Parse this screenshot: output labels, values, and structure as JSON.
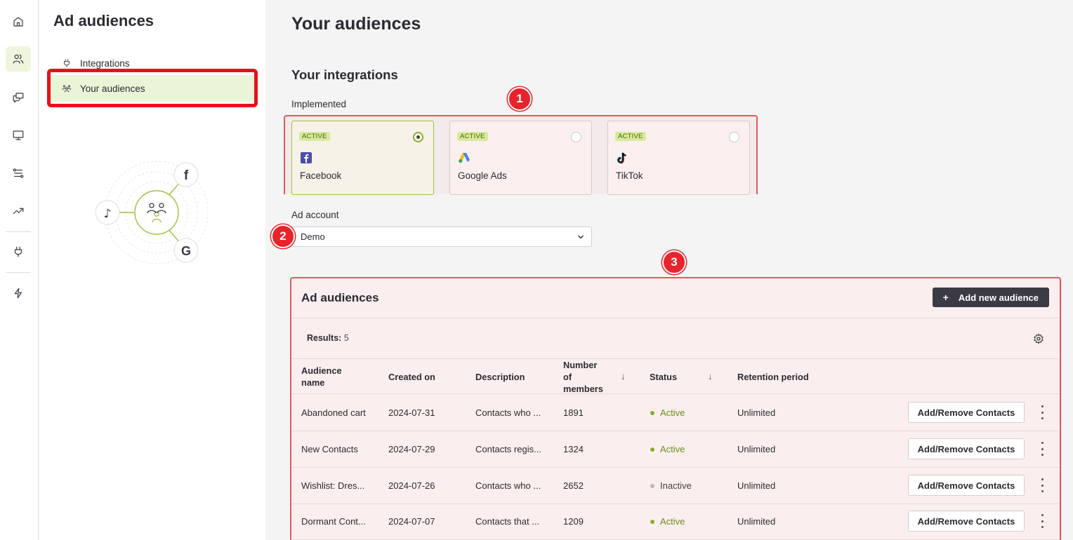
{
  "rail": {
    "icons": [
      "home-icon",
      "users-icon",
      "chat-icon",
      "monitor-icon",
      "automation-icon",
      "trend-icon",
      "plug-icon",
      "bolt-icon"
    ],
    "active": "users-icon"
  },
  "subnav": {
    "title": "Ad audiences",
    "items": [
      {
        "label": "Integrations",
        "icon": "plug-icon"
      },
      {
        "label": "Your audiences",
        "icon": "audience-icon",
        "active": true
      }
    ]
  },
  "main": {
    "title": "Your audiences",
    "integrations_title": "Your integrations",
    "implemented_label": "Implemented",
    "integrations": [
      {
        "badge": "ACTIVE",
        "name": "Facebook",
        "icon": "facebook-icon",
        "selected": true
      },
      {
        "badge": "ACTIVE",
        "name": "Google Ads",
        "icon": "google-ads-icon",
        "selected": false
      },
      {
        "badge": "ACTIVE",
        "name": "TikTok",
        "icon": "tiktok-icon",
        "selected": false
      }
    ],
    "ad_account_label": "Ad account",
    "ad_account_value": "Demo",
    "markers": [
      "1",
      "2",
      "3"
    ]
  },
  "audiences": {
    "title": "Ad audiences",
    "add_button": "Add new audience",
    "results_label": "Results:",
    "results_count": "5",
    "columns": [
      "Audience name",
      "Created on",
      "Description",
      "Number of members",
      "Status",
      "Retention period"
    ],
    "rows": [
      {
        "name": "Abandoned cart",
        "created": "2024-07-31",
        "description": "Contacts who ...",
        "members": "1891",
        "status": "Active",
        "retention": "Unlimited",
        "action": "Add/Remove Contacts"
      },
      {
        "name": "New Contacts",
        "created": "2024-07-29",
        "description": "Contacts regis...",
        "members": "1324",
        "status": "Active",
        "retention": "Unlimited",
        "action": "Add/Remove Contacts"
      },
      {
        "name": "Wishlist: Dres...",
        "created": "2024-07-26",
        "description": "Contacts who ...",
        "members": "2652",
        "status": "Inactive",
        "retention": "Unlimited",
        "action": "Add/Remove Contacts"
      },
      {
        "name": "Dormant Cont...",
        "created": "2024-07-07",
        "description": "Contacts that ...",
        "members": "1209",
        "status": "Active",
        "retention": "Unlimited",
        "action": "Add/Remove Contacts"
      }
    ]
  },
  "colors": {
    "accent": "#86ad2a",
    "highlight": "#e8101a",
    "active_bg": "#eaf5d8",
    "dark_button": "#3b3a45"
  }
}
